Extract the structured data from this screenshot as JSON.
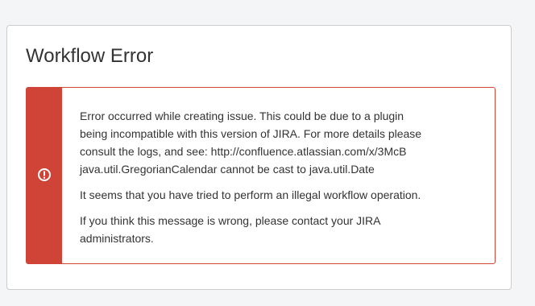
{
  "panel": {
    "title": "Workflow Error"
  },
  "error": {
    "icon": "error-icon",
    "accent_color": "#d04437",
    "line1": "Error occurred while creating issue. This could be due to a plugin",
    "line2": "being incompatible with this version of JIRA. For more details please",
    "line3": "consult the logs, and see: http://confluence.atlassian.com/x/3McB",
    "line4": "java.util.GregorianCalendar cannot be cast to java.util.Date",
    "message2": "It seems that you have tried to perform an illegal workflow operation.",
    "message3_line1": "If you think this message is wrong, please contact your JIRA",
    "message3_line2": "administrators."
  }
}
